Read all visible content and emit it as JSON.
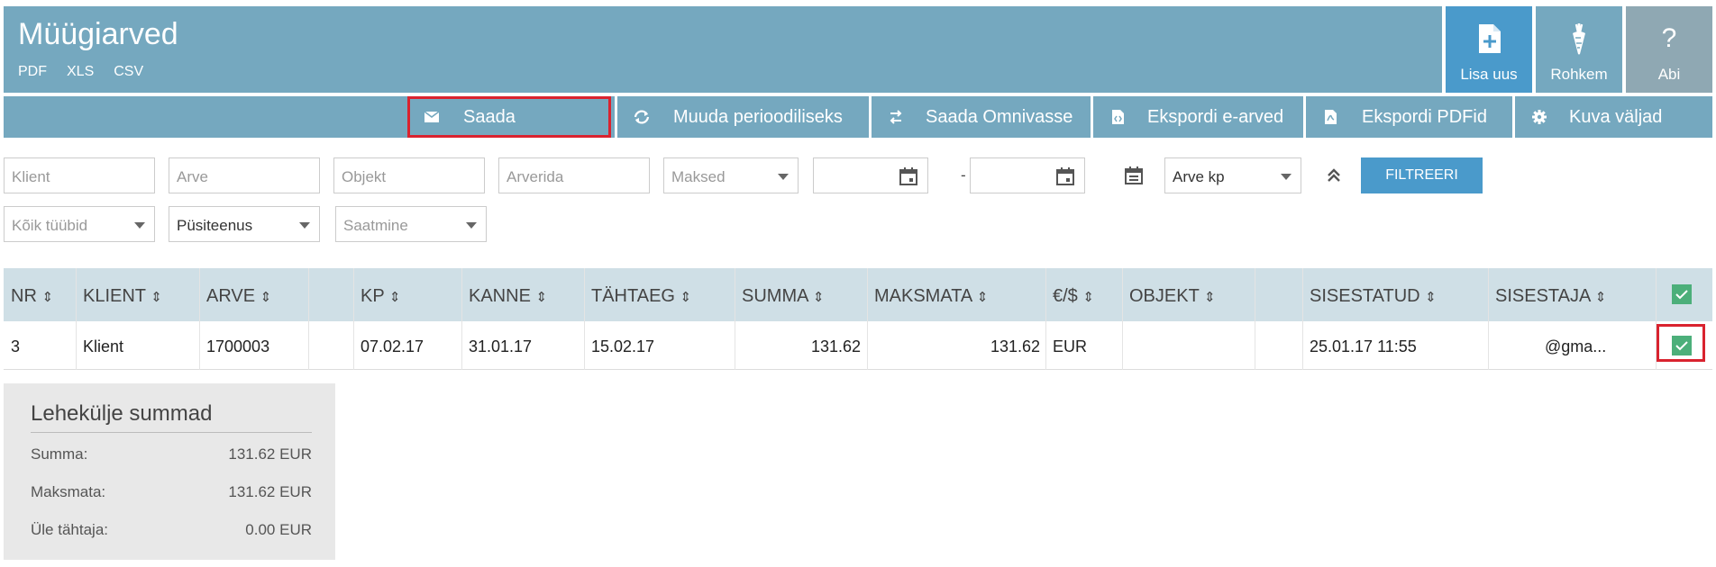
{
  "header": {
    "title": "Müügiarved",
    "exports": [
      "PDF",
      "XLS",
      "CSV"
    ],
    "buttons": {
      "add_label": "Lisa uus",
      "more_label": "Rohkem",
      "help_label": "Abi"
    }
  },
  "toolbar": {
    "send": "Saada",
    "periodic": "Muuda perioodiliseks",
    "omniva": "Saada Omnivasse",
    "export_einvoices": "Ekspordi e-arved",
    "export_pdfs": "Ekspordi PDFid",
    "show_fields": "Kuva väljad"
  },
  "filters": {
    "client_placeholder": "Klient",
    "invoice_placeholder": "Arve",
    "object_placeholder": "Objekt",
    "rows_placeholder": "Arverida",
    "payments": "Maksed",
    "date_separator": "-",
    "date_type": "Arve kp",
    "filter_button": "FILTREERI",
    "types": "Kõik tüübid",
    "service": "Püsiteenus",
    "sending": "Saatmine"
  },
  "table": {
    "columns": {
      "nr": "NR",
      "client": "KLIENT",
      "invoice": "ARVE",
      "kp": "KP",
      "kanne": "KANNE",
      "due": "TÄHTAEG",
      "sum": "SUMMA",
      "unpaid": "MAKSMATA",
      "currency": "€/$",
      "object": "OBJEKT",
      "entered": "SISESTATUD",
      "enterer": "SISESTAJA"
    },
    "rows": [
      {
        "nr": "3",
        "client": "Klient",
        "invoice": "1700003",
        "kp": "07.02.17",
        "kanne": "31.01.17",
        "due": "15.02.17",
        "sum": "131.62",
        "unpaid": "131.62",
        "currency": "EUR",
        "object": "",
        "entered": "25.01.17 11:55",
        "enterer": "@gma...",
        "checked": true
      }
    ]
  },
  "summary": {
    "title": "Lehekülje summad",
    "rows": [
      {
        "label": "Summa:",
        "value": "131.62 EUR"
      },
      {
        "label": "Maksmata:",
        "value": "131.62 EUR"
      },
      {
        "label": "Üle tähtaja:",
        "value": "0.00 EUR"
      }
    ]
  },
  "colors": {
    "header_bg": "#75a8bf",
    "primary_button": "#4a9acb",
    "help_button": "#8fa8b3",
    "table_header_bg": "#cfdfe6",
    "checkbox": "#4caf7a",
    "highlight": "#d9232f"
  }
}
